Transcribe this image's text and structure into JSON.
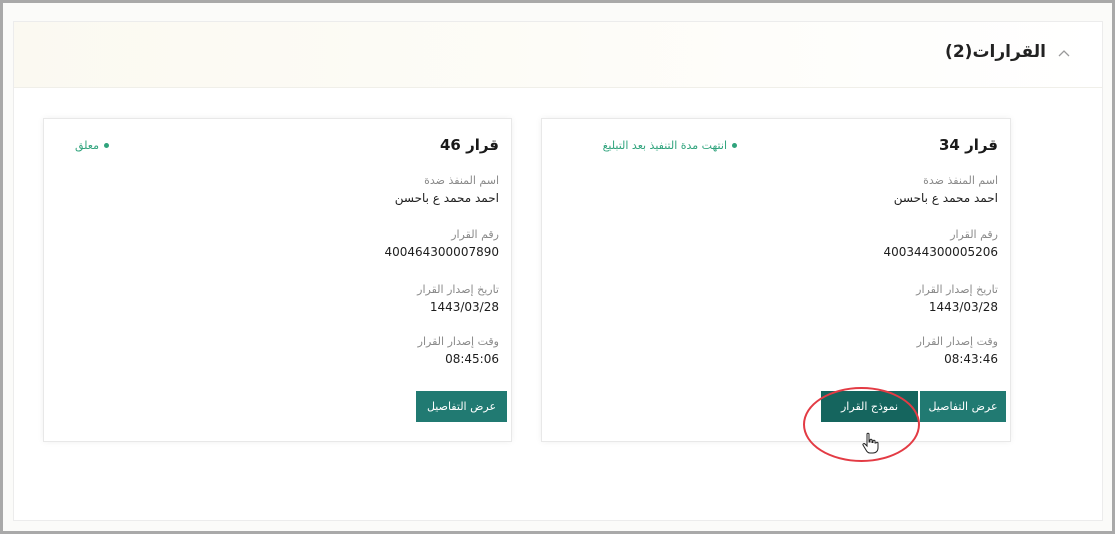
{
  "section": {
    "title": "القرارات(2)",
    "collapse_icon": "chevron-up-icon"
  },
  "decisions": [
    {
      "title": "قرار 34",
      "status": "انتهت مدة التنفيذ بعد التبليغ",
      "executor_label": "اسم المنفذ ضدة",
      "executor_value": "احمد محمد ع باحسن",
      "number_label": "رقم القرار",
      "number_value": "400344300005206",
      "date_label": "تاريخ إصدار القرار",
      "date_value": "1443/03/28",
      "time_label": "وقت إصدار القرار",
      "time_value": "08:43:46",
      "details_button": "عرض التفاصيل",
      "model_button": "نموذج القرار"
    },
    {
      "title": "قرار 46",
      "status": "معلق",
      "executor_label": "اسم المنفذ ضدة",
      "executor_value": "احمد محمد ع باحسن",
      "number_label": "رقم القرار",
      "number_value": "400464300007890",
      "date_label": "تاريخ إصدار القرار",
      "date_value": "1443/03/28",
      "time_label": "وقت إصدار القرار",
      "time_value": "08:45:06",
      "details_button": "عرض التفاصيل"
    }
  ],
  "colors": {
    "accent": "#217a72",
    "status": "#2fa37c",
    "highlight": "#e33b44"
  }
}
